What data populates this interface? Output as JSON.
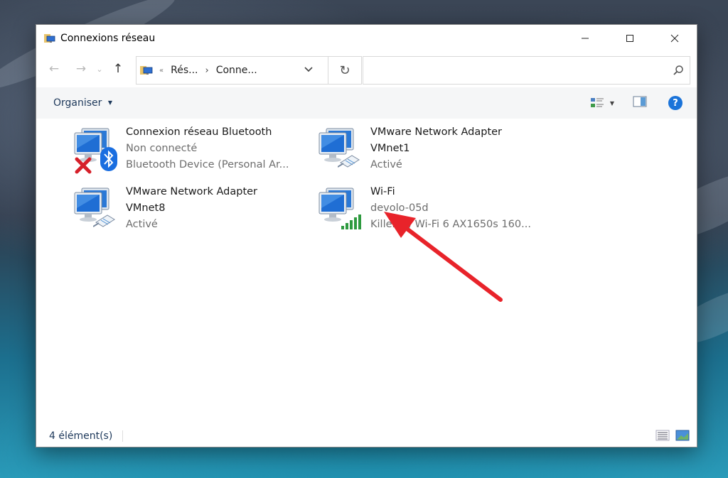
{
  "window": {
    "title": "Connexions réseau"
  },
  "address": {
    "breadcrumb_sep": "«",
    "crumb1": "Rés...",
    "crumb2": "Conne...",
    "search_placeholder": ""
  },
  "toolbar": {
    "organise_label": "Organiser",
    "help_label": "?"
  },
  "items": [
    {
      "name": "Connexion réseau Bluetooth",
      "line2": "Non connecté",
      "line3": "Bluetooth Device (Personal Ar..."
    },
    {
      "name": "VMware Network Adapter",
      "line2": "VMnet1",
      "line3": "Activé"
    },
    {
      "name": "VMware Network Adapter",
      "line2": "VMnet8",
      "line3": "Activé"
    },
    {
      "name": "Wi-Fi",
      "line2": "devolo-05d",
      "line3": "Killer(R) Wi-Fi 6 AX1650s 160..."
    }
  ],
  "status": {
    "count": "4 élément(s)"
  },
  "colors": {
    "accent": "#1a73d9",
    "link_text": "#1e395b",
    "arrow": "#e8232a"
  },
  "icons": {
    "network": "network-computers-icon",
    "bluetooth": "bluetooth-icon",
    "disconnected": "red-x-icon",
    "wifi": "wifi-signal-bars-icon",
    "cable": "ethernet-plug-icon"
  }
}
